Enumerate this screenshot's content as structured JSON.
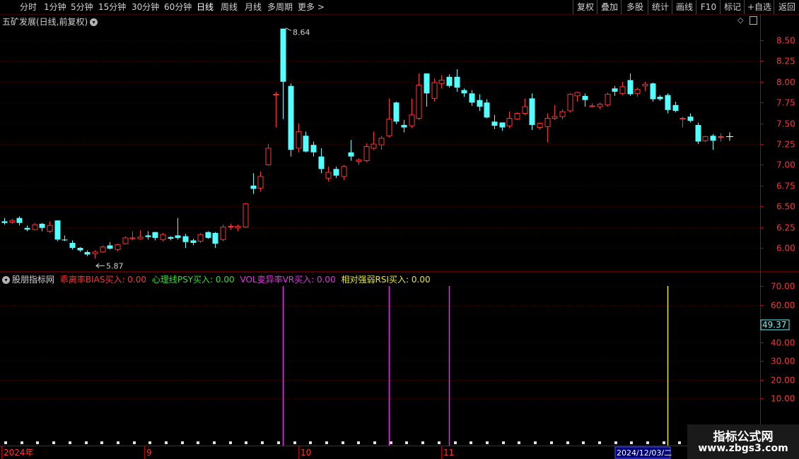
{
  "toolbar": {
    "periods": [
      "分时",
      "1分钟",
      "5分钟",
      "15分钟",
      "30分钟",
      "60分钟",
      "日线",
      "周线",
      "月线",
      "多周期",
      "更多 >"
    ],
    "active_period": "日线",
    "right_buttons": [
      "复权",
      "叠加",
      "多股",
      "统计",
      "画线",
      "F10",
      "标记",
      "+自选",
      "返回"
    ]
  },
  "main_panel": {
    "title": "五矿发展(日线,前复权)",
    "high_label": "8.64",
    "low_label": "5.87",
    "y_ticks": [
      "8.50",
      "8.25",
      "8.00",
      "7.75",
      "7.50",
      "7.25",
      "7.00",
      "6.75",
      "6.50",
      "6.25",
      "6.00"
    ]
  },
  "indicator_panel": {
    "name": "股朋指标网",
    "legend": [
      {
        "label": "乖离率BIAS买入: 0.00",
        "color": "#ff3232"
      },
      {
        "label": "心理线PSY买入: 0.00",
        "color": "#32dc32"
      },
      {
        "label": "VOL变异率VR买入: 0.00",
        "color": "#e632e6"
      },
      {
        "label": "相对强弱RSI买入: 0.00",
        "color": "#e6e632"
      }
    ],
    "y_ticks": [
      "70.00",
      "60.00",
      "40.00",
      "30.00",
      "20.00",
      "10.00"
    ],
    "current_value": "49.37"
  },
  "x_axis": {
    "labels": [
      "2024年",
      "9",
      "10",
      "11"
    ],
    "cursor_date": "2024/12/03/二"
  },
  "watermark": {
    "title": "指标公式网",
    "url": "www.zbgs3.com"
  },
  "colors": {
    "up": "#ff3232",
    "down": "#54ffff",
    "grid": "#3c0000",
    "axis": "#b40000",
    "vr": "#e632e6",
    "rsi": "#e6e632"
  },
  "chart_data": {
    "type": "candlestick",
    "title": "五矿发展(日线,前复权)",
    "y_range": [
      5.85,
      8.72
    ],
    "candles": [
      {
        "o": 6.32,
        "h": 6.36,
        "l": 6.28,
        "c": 6.3
      },
      {
        "o": 6.31,
        "h": 6.35,
        "l": 6.29,
        "c": 6.33
      },
      {
        "o": 6.36,
        "h": 6.38,
        "l": 6.27,
        "c": 6.3
      },
      {
        "o": 6.24,
        "h": 6.27,
        "l": 6.2,
        "c": 6.22
      },
      {
        "o": 6.22,
        "h": 6.3,
        "l": 6.21,
        "c": 6.28
      },
      {
        "o": 6.29,
        "h": 6.3,
        "l": 6.2,
        "c": 6.24
      },
      {
        "o": 6.2,
        "h": 6.32,
        "l": 6.18,
        "c": 6.27
      },
      {
        "o": 6.33,
        "h": 6.33,
        "l": 6.08,
        "c": 6.1
      },
      {
        "o": 6.1,
        "h": 6.15,
        "l": 6.08,
        "c": 6.09
      },
      {
        "o": 6.06,
        "h": 6.09,
        "l": 5.98,
        "c": 6.0
      },
      {
        "o": 6.0,
        "h": 6.01,
        "l": 5.95,
        "c": 5.97
      },
      {
        "o": 5.95,
        "h": 5.97,
        "l": 5.9,
        "c": 5.92
      },
      {
        "o": 5.93,
        "h": 5.97,
        "l": 5.87,
        "c": 5.95
      },
      {
        "o": 5.95,
        "h": 6.03,
        "l": 5.94,
        "c": 6.01
      },
      {
        "o": 6.03,
        "h": 6.07,
        "l": 5.98,
        "c": 5.99
      },
      {
        "o": 5.98,
        "h": 6.05,
        "l": 5.96,
        "c": 6.04
      },
      {
        "o": 6.05,
        "h": 6.14,
        "l": 6.04,
        "c": 6.12
      },
      {
        "o": 6.11,
        "h": 6.2,
        "l": 6.09,
        "c": 6.12
      },
      {
        "o": 6.11,
        "h": 6.21,
        "l": 6.1,
        "c": 6.13
      },
      {
        "o": 6.15,
        "h": 6.2,
        "l": 6.1,
        "c": 6.13
      },
      {
        "o": 6.19,
        "h": 6.19,
        "l": 6.09,
        "c": 6.12
      },
      {
        "o": 6.1,
        "h": 6.18,
        "l": 6.08,
        "c": 6.16
      },
      {
        "o": 6.13,
        "h": 6.14,
        "l": 6.09,
        "c": 6.11
      },
      {
        "o": 6.15,
        "h": 6.36,
        "l": 6.1,
        "c": 6.12
      },
      {
        "o": 6.14,
        "h": 6.17,
        "l": 6.0,
        "c": 6.07
      },
      {
        "o": 6.09,
        "h": 6.11,
        "l": 6.03,
        "c": 6.06
      },
      {
        "o": 6.08,
        "h": 6.18,
        "l": 6.06,
        "c": 6.16
      },
      {
        "o": 6.19,
        "h": 6.2,
        "l": 6.11,
        "c": 6.12
      },
      {
        "o": 6.18,
        "h": 6.19,
        "l": 6.0,
        "c": 6.05
      },
      {
        "o": 6.1,
        "h": 6.28,
        "l": 6.08,
        "c": 6.25
      },
      {
        "o": 6.26,
        "h": 6.29,
        "l": 6.22,
        "c": 6.26
      },
      {
        "o": 6.24,
        "h": 6.28,
        "l": 6.2,
        "c": 6.26
      },
      {
        "o": 6.25,
        "h": 6.54,
        "l": 6.24,
        "c": 6.53
      },
      {
        "o": 6.75,
        "h": 6.9,
        "l": 6.65,
        "c": 6.71
      },
      {
        "o": 6.72,
        "h": 6.92,
        "l": 6.68,
        "c": 6.86
      },
      {
        "o": 7.0,
        "h": 7.25,
        "l": 6.99,
        "c": 7.2
      },
      {
        "o": 7.85,
        "h": 7.88,
        "l": 7.45,
        "c": 7.85
      },
      {
        "o": 8.64,
        "h": 8.64,
        "l": 7.55,
        "c": 8.0
      },
      {
        "o": 7.95,
        "h": 7.98,
        "l": 7.1,
        "c": 7.18
      },
      {
        "o": 7.2,
        "h": 7.5,
        "l": 7.15,
        "c": 7.4
      },
      {
        "o": 7.35,
        "h": 7.4,
        "l": 7.15,
        "c": 7.16
      },
      {
        "o": 7.24,
        "h": 7.28,
        "l": 7.1,
        "c": 7.15
      },
      {
        "o": 7.1,
        "h": 7.2,
        "l": 6.9,
        "c": 6.95
      },
      {
        "o": 6.84,
        "h": 6.98,
        "l": 6.8,
        "c": 6.91
      },
      {
        "o": 6.95,
        "h": 6.98,
        "l": 6.84,
        "c": 6.87
      },
      {
        "o": 6.86,
        "h": 7.0,
        "l": 6.82,
        "c": 6.98
      },
      {
        "o": 7.15,
        "h": 7.3,
        "l": 7.05,
        "c": 7.1
      },
      {
        "o": 7.04,
        "h": 7.08,
        "l": 7.0,
        "c": 7.06
      },
      {
        "o": 7.05,
        "h": 7.26,
        "l": 7.03,
        "c": 7.22
      },
      {
        "o": 7.2,
        "h": 7.4,
        "l": 7.18,
        "c": 7.25
      },
      {
        "o": 7.24,
        "h": 7.35,
        "l": 7.18,
        "c": 7.32
      },
      {
        "o": 7.35,
        "h": 7.8,
        "l": 7.33,
        "c": 7.55
      },
      {
        "o": 7.75,
        "h": 7.76,
        "l": 7.49,
        "c": 7.52
      },
      {
        "o": 7.48,
        "h": 7.54,
        "l": 7.39,
        "c": 7.45
      },
      {
        "o": 7.47,
        "h": 7.8,
        "l": 7.44,
        "c": 7.6
      },
      {
        "o": 7.56,
        "h": 8.1,
        "l": 7.54,
        "c": 7.96
      },
      {
        "o": 8.1,
        "h": 8.1,
        "l": 7.7,
        "c": 7.86
      },
      {
        "o": 7.8,
        "h": 8.04,
        "l": 7.76,
        "c": 7.99
      },
      {
        "o": 7.98,
        "h": 8.08,
        "l": 7.92,
        "c": 8.02
      },
      {
        "o": 8.06,
        "h": 8.09,
        "l": 7.93,
        "c": 7.95
      },
      {
        "o": 8.06,
        "h": 8.15,
        "l": 7.88,
        "c": 7.93
      },
      {
        "o": 7.9,
        "h": 7.92,
        "l": 7.82,
        "c": 7.86
      },
      {
        "o": 7.86,
        "h": 7.9,
        "l": 7.71,
        "c": 7.75
      },
      {
        "o": 7.78,
        "h": 7.85,
        "l": 7.65,
        "c": 7.7
      },
      {
        "o": 7.75,
        "h": 7.79,
        "l": 7.56,
        "c": 7.57
      },
      {
        "o": 7.52,
        "h": 7.6,
        "l": 7.43,
        "c": 7.47
      },
      {
        "o": 7.51,
        "h": 7.51,
        "l": 7.41,
        "c": 7.45
      },
      {
        "o": 7.47,
        "h": 7.64,
        "l": 7.44,
        "c": 7.56
      },
      {
        "o": 7.55,
        "h": 7.63,
        "l": 7.54,
        "c": 7.62
      },
      {
        "o": 7.62,
        "h": 7.8,
        "l": 7.6,
        "c": 7.7
      },
      {
        "o": 7.8,
        "h": 7.86,
        "l": 7.42,
        "c": 7.48
      },
      {
        "o": 7.45,
        "h": 7.51,
        "l": 7.42,
        "c": 7.5
      },
      {
        "o": 7.46,
        "h": 7.62,
        "l": 7.27,
        "c": 7.56
      },
      {
        "o": 7.56,
        "h": 7.72,
        "l": 7.54,
        "c": 7.58
      },
      {
        "o": 7.58,
        "h": 7.67,
        "l": 7.55,
        "c": 7.64
      },
      {
        "o": 7.65,
        "h": 7.86,
        "l": 7.63,
        "c": 7.85
      },
      {
        "o": 7.83,
        "h": 7.88,
        "l": 7.76,
        "c": 7.87
      },
      {
        "o": 7.83,
        "h": 7.86,
        "l": 7.7,
        "c": 7.78
      },
      {
        "o": 7.7,
        "h": 7.74,
        "l": 7.69,
        "c": 7.71
      },
      {
        "o": 7.7,
        "h": 7.75,
        "l": 7.67,
        "c": 7.73
      },
      {
        "o": 7.72,
        "h": 7.87,
        "l": 7.7,
        "c": 7.85
      },
      {
        "o": 7.92,
        "h": 7.95,
        "l": 7.83,
        "c": 7.88
      },
      {
        "o": 7.86,
        "h": 8.0,
        "l": 7.84,
        "c": 7.94
      },
      {
        "o": 8.02,
        "h": 8.1,
        "l": 7.83,
        "c": 7.85
      },
      {
        "o": 7.86,
        "h": 7.93,
        "l": 7.82,
        "c": 7.91
      },
      {
        "o": 7.95,
        "h": 8.0,
        "l": 7.89,
        "c": 7.97
      },
      {
        "o": 7.98,
        "h": 7.99,
        "l": 7.76,
        "c": 7.79
      },
      {
        "o": 7.82,
        "h": 7.84,
        "l": 7.77,
        "c": 7.79
      },
      {
        "o": 7.84,
        "h": 7.86,
        "l": 7.62,
        "c": 7.66
      },
      {
        "o": 7.72,
        "h": 7.76,
        "l": 7.63,
        "c": 7.65
      },
      {
        "o": 7.55,
        "h": 7.58,
        "l": 7.45,
        "c": 7.56
      },
      {
        "o": 7.58,
        "h": 7.62,
        "l": 7.51,
        "c": 7.53
      },
      {
        "o": 7.48,
        "h": 7.51,
        "l": 7.25,
        "c": 7.28
      },
      {
        "o": 7.29,
        "h": 7.35,
        "l": 7.27,
        "c": 7.34
      },
      {
        "o": 7.35,
        "h": 7.37,
        "l": 7.18,
        "c": 7.29
      },
      {
        "o": 7.34,
        "h": 7.38,
        "l": 7.28,
        "c": 7.34
      }
    ],
    "indicator_y_range": [
      5,
      70
    ],
    "vr_buy_signals": [
      37,
      51,
      59
    ],
    "rsi_buy_signals": [
      88
    ]
  }
}
